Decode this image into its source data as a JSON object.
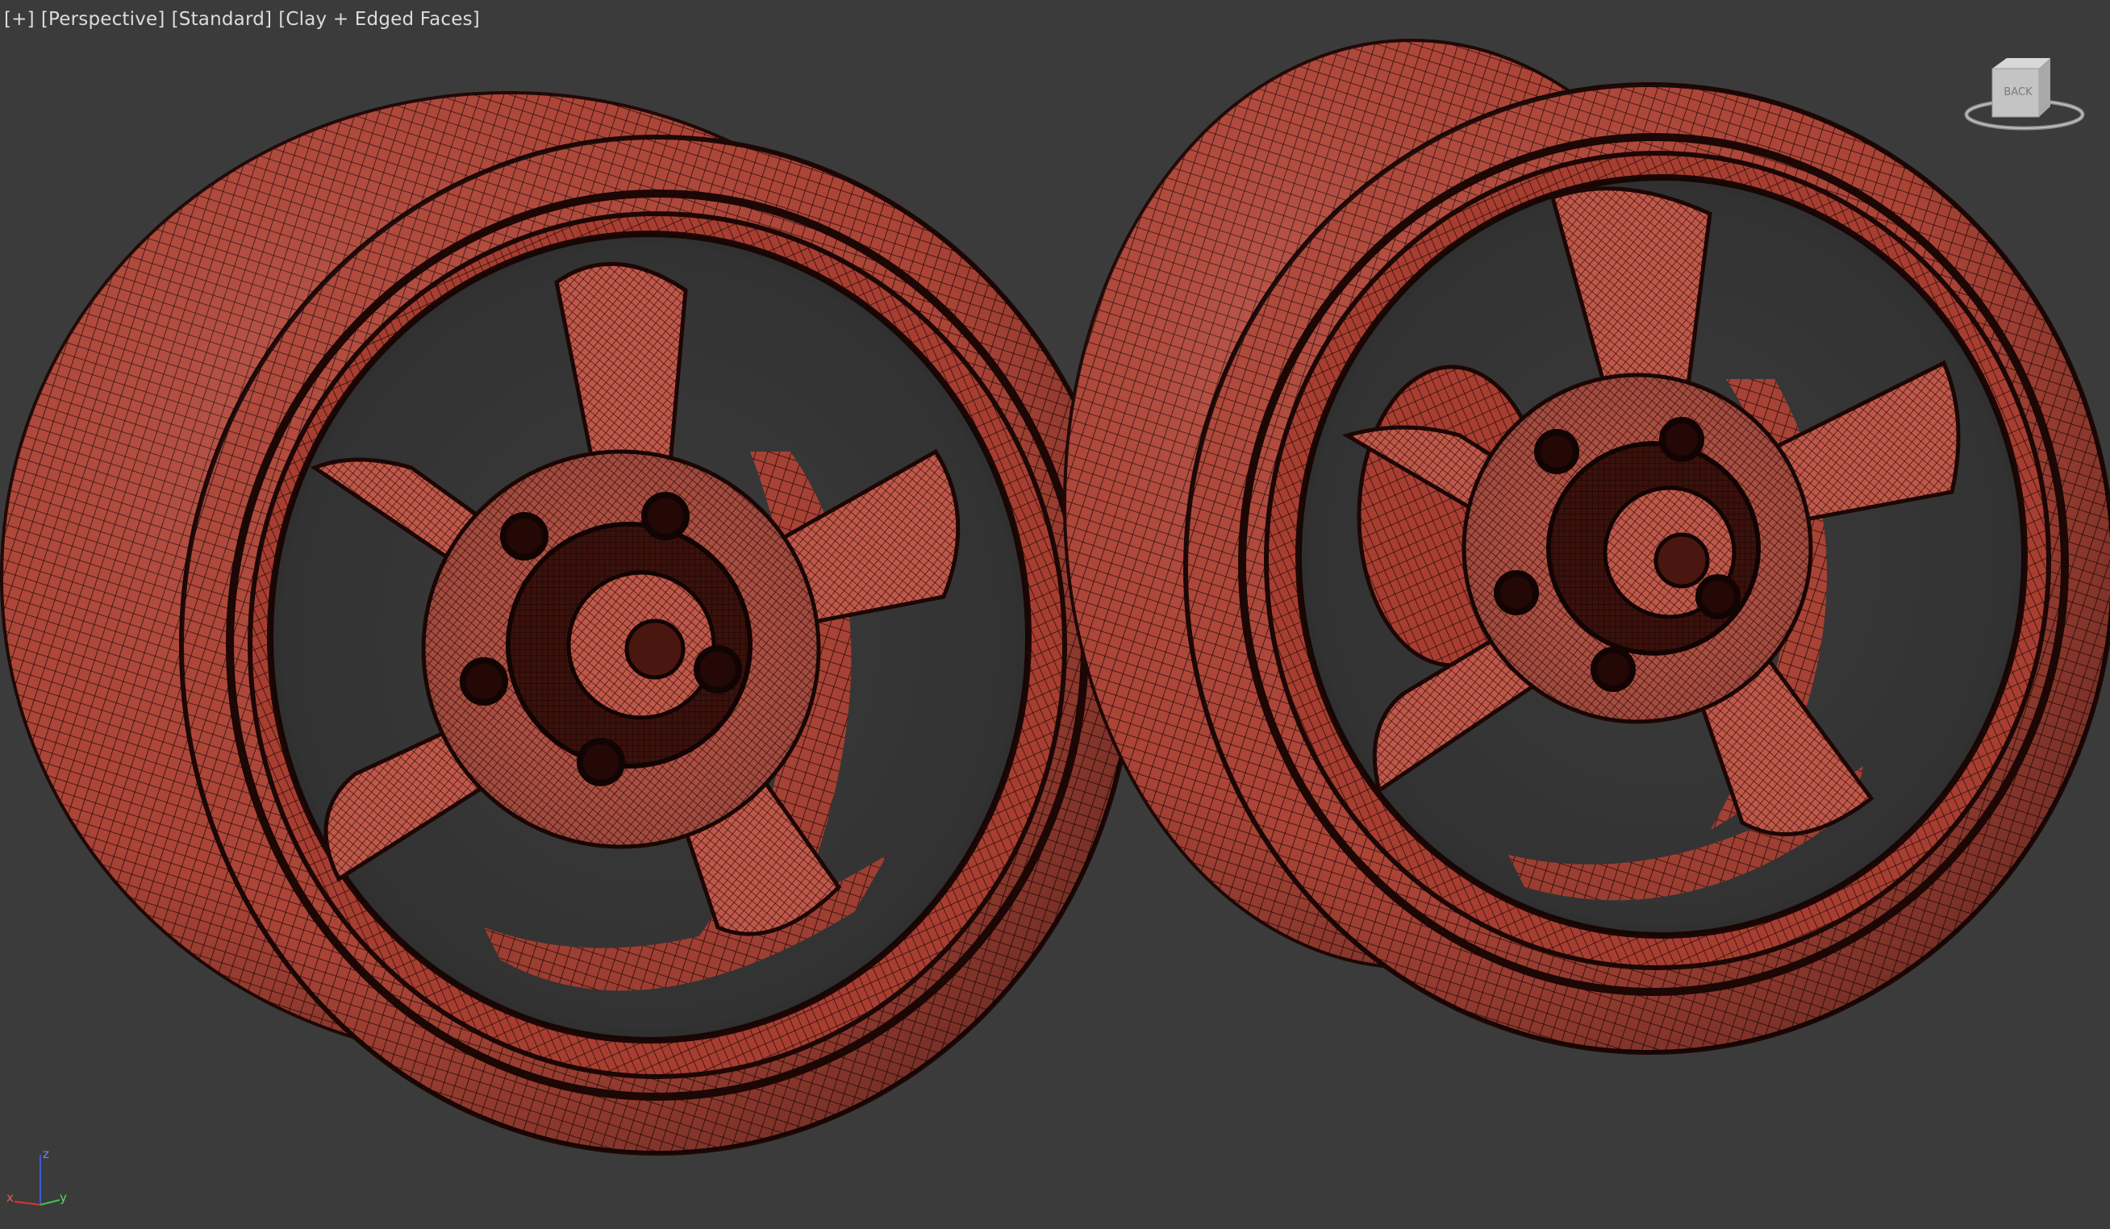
{
  "viewport": {
    "menu_label": "[+]",
    "view_label": "[Perspective]",
    "shading_style_label": "[Standard]",
    "display_mode_label": "[Clay + Edged Faces]"
  },
  "viewcube": {
    "face_label": "BACK"
  },
  "axis_tripod": {
    "x_label": "x",
    "y_label": "y",
    "z_label": "z"
  },
  "colors": {
    "background": "#3b3b3b",
    "clay": "#b5483a",
    "wire": "#2a0c08",
    "axis_x": "#d23a2a",
    "axis_y": "#3cc64a",
    "axis_z": "#3a5ad8"
  }
}
